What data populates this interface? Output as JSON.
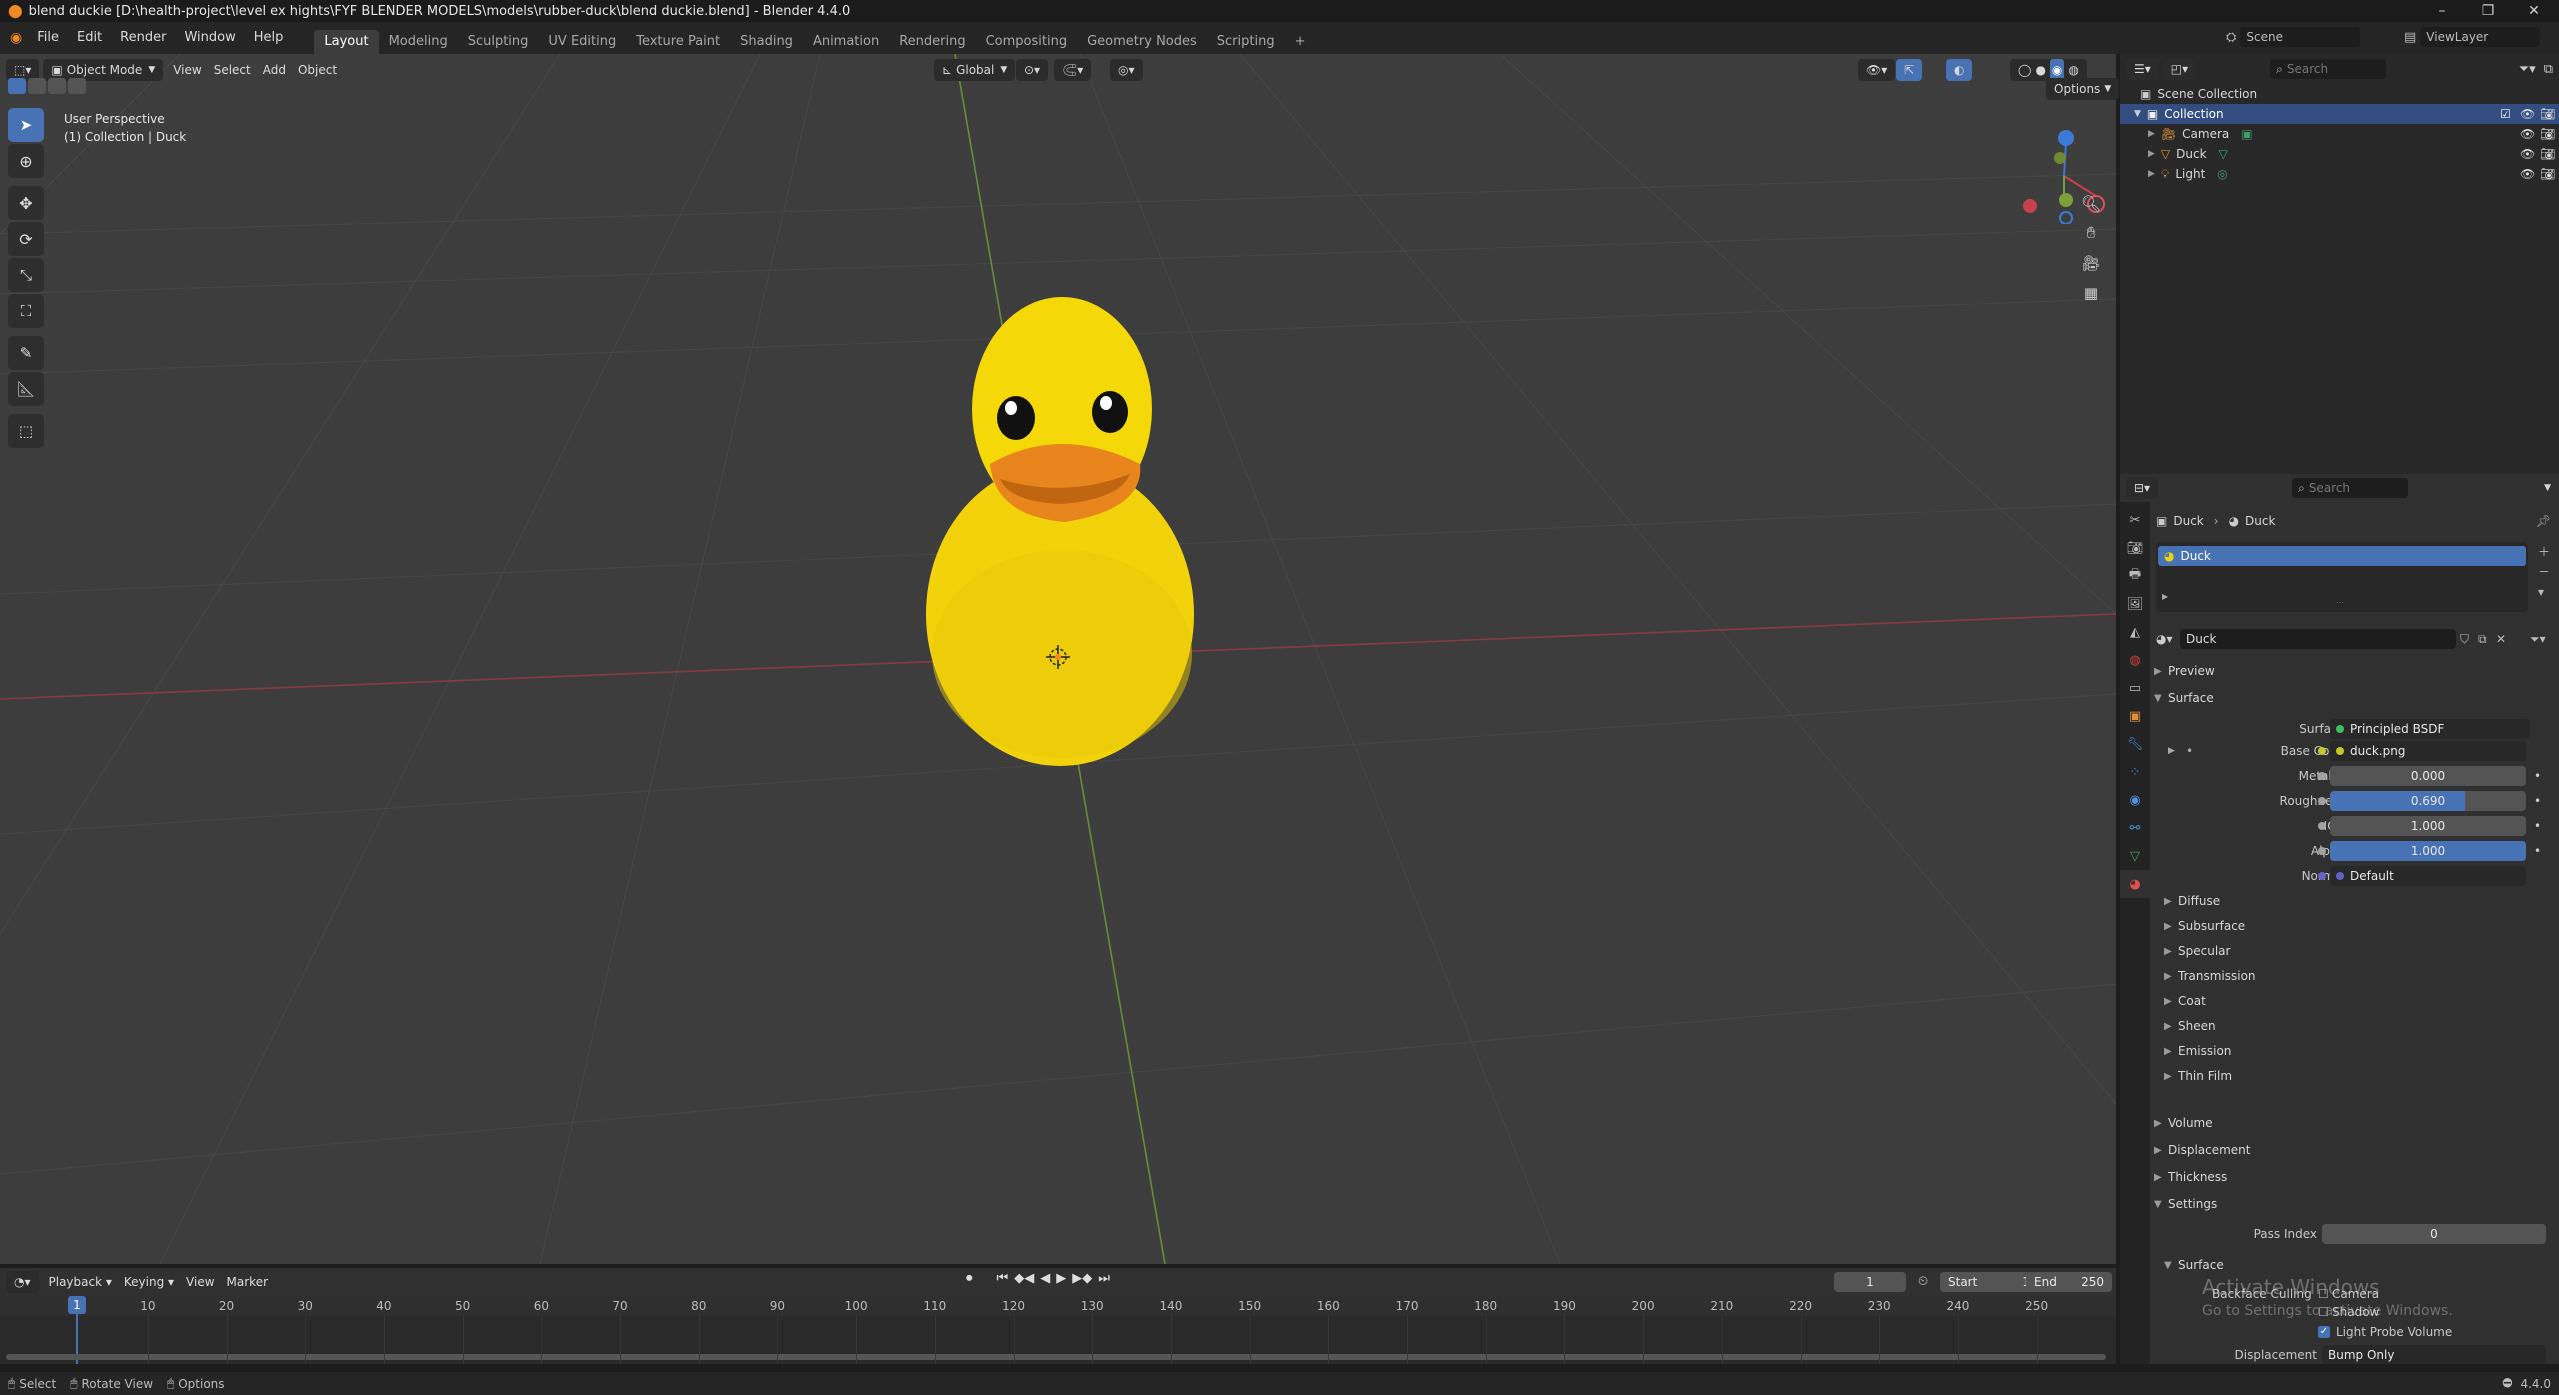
{
  "window": {
    "title": "blend duckie [D:\\health-project\\level ex hights\\FYF BLENDER MODELS\\models\\rubber-duck\\blend duckie.blend] - Blender 4.4.0",
    "controls": [
      "–",
      "❐",
      "✕"
    ]
  },
  "menu": [
    "File",
    "Edit",
    "Render",
    "Window",
    "Help"
  ],
  "workspaces": [
    "Layout",
    "Modeling",
    "Sculpting",
    "UV Editing",
    "Texture Paint",
    "Shading",
    "Animation",
    "Rendering",
    "Compositing",
    "Geometry Nodes",
    "Scripting",
    "+"
  ],
  "active_workspace": "Layout",
  "scene": {
    "label": "Scene",
    "view_layer": "ViewLayer"
  },
  "viewport": {
    "mode": "Object Mode",
    "menus": [
      "View",
      "Select",
      "Add",
      "Object"
    ],
    "transform_orientation": "Global",
    "options_label": "Options",
    "info_line1": "User Perspective",
    "info_line2": "(1) Collection | Duck",
    "gizmo_axes": [
      "X",
      "Y",
      "Z"
    ]
  },
  "outliner": {
    "search_placeholder": "Search",
    "root": "Scene Collection",
    "collection": "Collection",
    "items": [
      "Camera",
      "Duck",
      "Light"
    ]
  },
  "properties": {
    "search_placeholder": "Search",
    "breadcrumb": [
      "Duck",
      "Duck"
    ],
    "material_slot": "Duck",
    "material_name": "Duck",
    "sections": {
      "preview": "Preview",
      "surface": "Surface",
      "volume": "Volume",
      "displacement": "Displacement",
      "thickness": "Thickness",
      "settings": "Settings"
    },
    "surface_shader": {
      "label": "Surface",
      "value": "Principled BSDF"
    },
    "inputs": [
      {
        "label": "Base Color",
        "value": "duck.png",
        "kind": "link",
        "dot": "#c7c729"
      },
      {
        "label": "Metallic",
        "value": "0.000",
        "kind": "slider",
        "fill": 0.0,
        "dot": "#a1a1a1"
      },
      {
        "label": "Roughness",
        "value": "0.690",
        "kind": "slider",
        "fill": 0.69,
        "dot": "#a1a1a1"
      },
      {
        "label": "IOR",
        "value": "1.000",
        "kind": "slider",
        "fill": 0.0,
        "dot": "#a1a1a1"
      },
      {
        "label": "Alpha",
        "value": "1.000",
        "kind": "slider",
        "fill": 1.0,
        "dot": "#a1a1a1"
      },
      {
        "label": "Normal",
        "value": "Default",
        "kind": "link",
        "dot": "#6363c7"
      }
    ],
    "subpanels": [
      "Diffuse",
      "Subsurface",
      "Specular",
      "Transmission",
      "Coat",
      "Sheen",
      "Emission",
      "Thin Film"
    ],
    "settings": {
      "pass_index_label": "Pass Index",
      "pass_index": "0",
      "surface_sub": "Surface",
      "backface_culling": "Backface Culling",
      "camera": "Camera",
      "shadow": "Shadow",
      "light_probe_volume": "Light Probe Volume",
      "displacement_label": "Displacement",
      "displacement_value": "Bump Only"
    }
  },
  "timeline": {
    "menus": [
      "Playback",
      "Keying",
      "View",
      "Marker"
    ],
    "current_frame": "1",
    "start_label": "Start",
    "start": "1",
    "end_label": "End",
    "end": "250",
    "ticks": [
      "1",
      "10",
      "20",
      "30",
      "40",
      "50",
      "60",
      "70",
      "80",
      "90",
      "100",
      "110",
      "120",
      "130",
      "140",
      "150",
      "160",
      "170",
      "180",
      "190",
      "200",
      "210",
      "220",
      "230",
      "240",
      "250"
    ]
  },
  "statusbar": {
    "select": "Select",
    "rotate": "Rotate View",
    "options": "Options",
    "version": "4.4.0"
  },
  "watermark": {
    "line1": "Activate Windows",
    "line2": "Go to Settings to activate Windows."
  },
  "colors": {
    "accent": "#4772b3",
    "duck_body": "#f2d20a",
    "duck_beak": "#e8851c",
    "x_axis": "#c8404a",
    "y_axis": "#7ea03a",
    "viewport_bg": "#3d3d3d"
  }
}
